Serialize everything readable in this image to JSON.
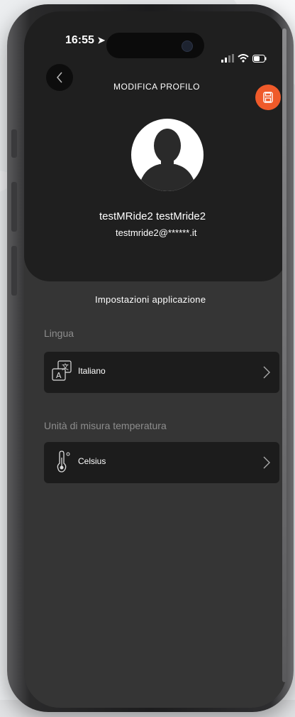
{
  "status_bar": {
    "time": "16:55"
  },
  "header": {
    "title": "MODIFICA PROFILO"
  },
  "profile": {
    "name": "testMRide2 testMride2",
    "email": "testmride2@******.it"
  },
  "settings": {
    "section_title": "Impostazioni applicazione",
    "language": {
      "label": "Lingua",
      "value": "Italiano",
      "icon": "translate-icon"
    },
    "temperature": {
      "label": "Unità di misura temperatura",
      "value": "Celsius",
      "icon": "thermometer-icon"
    }
  },
  "colors": {
    "accent": "#ef5a2a",
    "background": "#353535",
    "card": "#1f1f1f",
    "row": "#1c1c1c"
  }
}
